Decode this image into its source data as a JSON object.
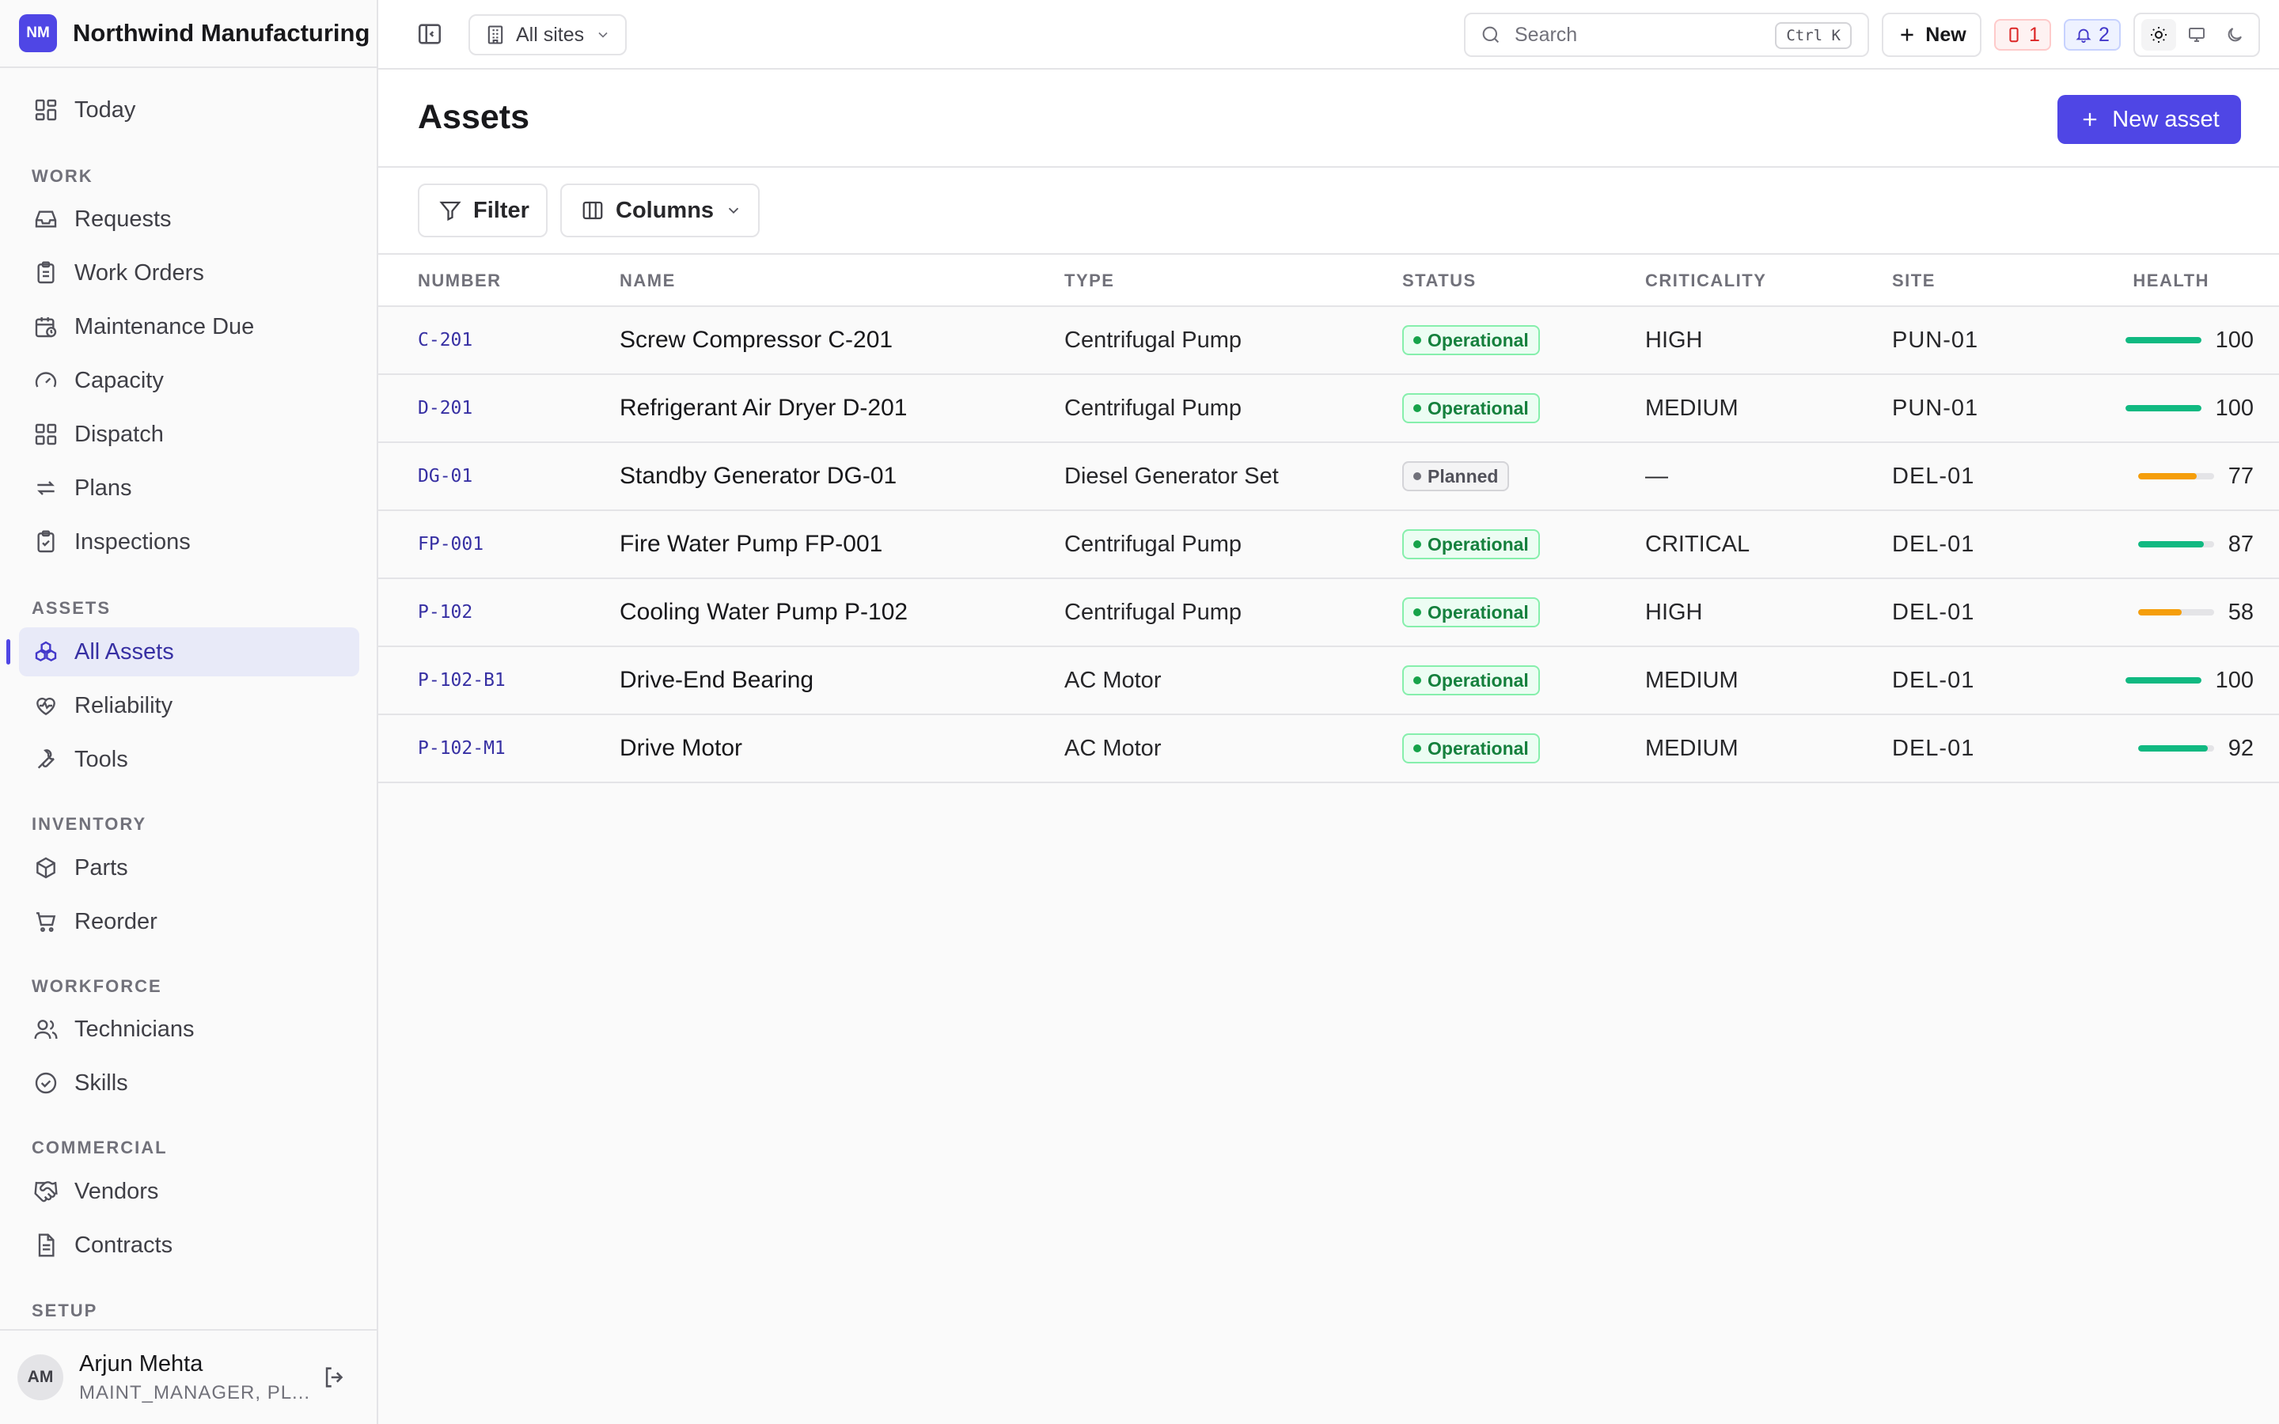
{
  "brand": {
    "logo_text": "NM",
    "name": "Northwind Manufacturing"
  },
  "sidebar": {
    "today": "Today",
    "sections": {
      "work": "WORK",
      "assets": "ASSETS",
      "inventory": "INVENTORY",
      "workforce": "WORKFORCE",
      "commercial": "COMMERCIAL",
      "setup": "SETUP"
    },
    "items": {
      "requests": "Requests",
      "work_orders": "Work Orders",
      "maintenance_due": "Maintenance Due",
      "capacity": "Capacity",
      "dispatch": "Dispatch",
      "plans": "Plans",
      "inspections": "Inspections",
      "all_assets": "All Assets",
      "reliability": "Reliability",
      "tools": "Tools",
      "parts": "Parts",
      "reorder": "Reorder",
      "technicians": "Technicians",
      "skills": "Skills",
      "vendors": "Vendors",
      "contracts": "Contracts"
    },
    "active_item": "all_assets"
  },
  "user": {
    "initials": "AM",
    "name": "Arjun Mehta",
    "role": "MAINT_MANAGER, PL..."
  },
  "topbar": {
    "site_select": "All sites",
    "search_placeholder": "Search",
    "search_shortcut": "Ctrl K",
    "new_label": "New",
    "alerts_count": "1",
    "notifications_count": "2",
    "theme_selected": "light"
  },
  "page": {
    "title": "Assets",
    "new_asset_label": "New asset"
  },
  "toolbar": {
    "filter_label": "Filter",
    "columns_label": "Columns"
  },
  "table": {
    "headers": {
      "number": "NUMBER",
      "name": "NAME",
      "type": "TYPE",
      "status": "STATUS",
      "criticality": "CRITICALITY",
      "site": "SITE",
      "health": "HEALTH"
    },
    "rows": [
      {
        "number": "C-201",
        "name": "Screw Compressor C-201",
        "type": "Centrifugal Pump",
        "status": "Operational",
        "criticality": "HIGH",
        "site": "PUN-01",
        "health": "100"
      },
      {
        "number": "D-201",
        "name": "Refrigerant Air Dryer D-201",
        "type": "Centrifugal Pump",
        "status": "Operational",
        "criticality": "MEDIUM",
        "site": "PUN-01",
        "health": "100"
      },
      {
        "number": "DG-01",
        "name": "Standby Generator DG-01",
        "type": "Diesel Generator Set",
        "status": "Planned",
        "criticality": "—",
        "site": "DEL-01",
        "health": "77"
      },
      {
        "number": "FP-001",
        "name": "Fire Water Pump FP-001",
        "type": "Centrifugal Pump",
        "status": "Operational",
        "criticality": "CRITICAL",
        "site": "DEL-01",
        "health": "87"
      },
      {
        "number": "P-102",
        "name": "Cooling Water Pump P-102",
        "type": "Centrifugal Pump",
        "status": "Operational",
        "criticality": "HIGH",
        "site": "DEL-01",
        "health": "58"
      },
      {
        "number": "P-102-B1",
        "name": "Drive-End Bearing",
        "type": "AC Motor",
        "status": "Operational",
        "criticality": "MEDIUM",
        "site": "DEL-01",
        "health": "100"
      },
      {
        "number": "P-102-M1",
        "name": "Drive Motor",
        "type": "AC Motor",
        "status": "Operational",
        "criticality": "MEDIUM",
        "site": "DEL-01",
        "health": "92"
      }
    ]
  },
  "colors": {
    "accent": "#4f46e5",
    "health_good": "#10b981",
    "health_warn": "#f59e0b",
    "status_operational": "#16a34a",
    "status_planned": "#71717a",
    "alert_red": "#dc2626"
  }
}
